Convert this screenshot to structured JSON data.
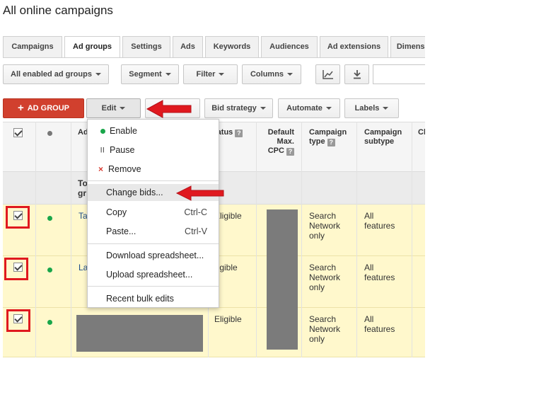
{
  "page": {
    "title": "All online campaigns"
  },
  "tabs": [
    {
      "label": "Campaigns",
      "active": false
    },
    {
      "label": "Ad groups",
      "active": true
    },
    {
      "label": "Settings",
      "active": false
    },
    {
      "label": "Ads",
      "active": false
    },
    {
      "label": "Keywords",
      "active": false
    },
    {
      "label": "Audiences",
      "active": false
    },
    {
      "label": "Ad extensions",
      "active": false
    },
    {
      "label": "Dimensions",
      "active": false
    }
  ],
  "toolbar1": {
    "filter_view": "All enabled ad groups",
    "segment": "Segment",
    "filter": "Filter",
    "columns": "Columns",
    "chart_icon": "line-chart-icon",
    "download_icon": "download-icon"
  },
  "toolbar2": {
    "add_label": "AD GROUP",
    "edit": "Edit",
    "bid_strategy": "Bid strategy",
    "automate": "Automate",
    "labels": "Labels"
  },
  "edit_menu": {
    "enable": "Enable",
    "pause": "Pause",
    "remove": "Remove",
    "change_bids": "Change bids...",
    "copy": "Copy",
    "copy_shortcut": "Ctrl-C",
    "paste": "Paste...",
    "paste_shortcut": "Ctrl-V",
    "download_spreadsheet": "Download spreadsheet...",
    "upload_spreadsheet": "Upload spreadsheet...",
    "recent_bulk_edits": "Recent bulk edits"
  },
  "table": {
    "headers": {
      "ad_group_partial": "Ad",
      "status_partial": "tatus",
      "default_max_cpc_1": "Default",
      "default_max_cpc_2": "Max.",
      "default_max_cpc_3": "CPC",
      "campaign_type_1": "Campaign",
      "campaign_type_2": "type",
      "campaign_subtype_1": "Campaign",
      "campaign_subtype_2": "subtype",
      "clicks_partial": "Cl"
    },
    "total_row": {
      "label_1": "To",
      "label_2": "gr"
    },
    "rows": [
      {
        "name_partial": "Ta",
        "status": "Eligible",
        "type_1": "Search",
        "type_2": "Network",
        "type_3": "only",
        "subtype_1": "All",
        "subtype_2": "features",
        "checked": true
      },
      {
        "name_partial": "La",
        "status": "ligible",
        "type_1": "Search",
        "type_2": "Network",
        "type_3": "only",
        "subtype_1": "All",
        "subtype_2": "features",
        "checked": true
      },
      {
        "name_partial": "",
        "status": "Eligible",
        "type_1": "Search",
        "type_2": "Network",
        "type_3": "only",
        "subtype_1": "All",
        "subtype_2": "features",
        "checked": true
      }
    ]
  },
  "annotation_color": "#e0191f",
  "enabled_color": "#19a64a"
}
